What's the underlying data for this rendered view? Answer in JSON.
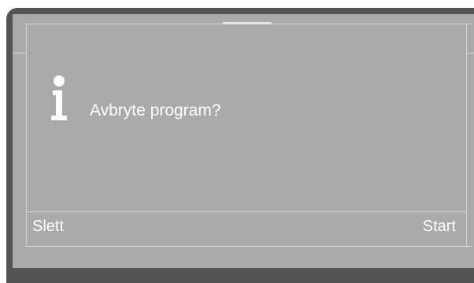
{
  "dialog": {
    "icon": "info-icon",
    "message": "Avbryte program?"
  },
  "softkeys": {
    "left_label": "Slett",
    "right_label": "Start"
  },
  "colors": {
    "frame": "#545456",
    "panel": "#a9aaac",
    "lines": "#d6d6d8",
    "text": "#ffffff"
  }
}
